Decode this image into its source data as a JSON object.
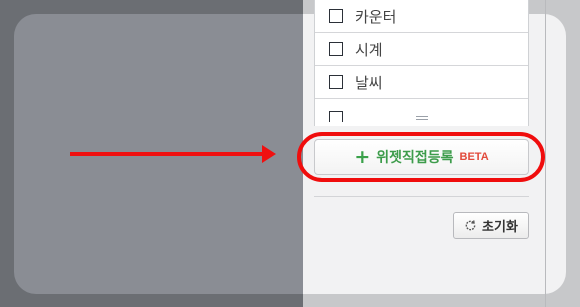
{
  "widget_list": {
    "items": [
      {
        "label": "카운터",
        "checked": false
      },
      {
        "label": "시계",
        "checked": false
      },
      {
        "label": "날씨",
        "checked": false
      },
      {
        "label": "",
        "checked": false
      }
    ]
  },
  "register_button": {
    "label": "위젯직접등록",
    "badge": "BETA",
    "icon": "plus-icon"
  },
  "reset_button": {
    "label": "초기화",
    "icon": "refresh-icon"
  },
  "annotation": {
    "arrow_color": "#f01010",
    "highlight_color": "#f00d0d"
  },
  "colors": {
    "register_text": "#3d9c4b",
    "beta_text": "#e24a3b"
  }
}
